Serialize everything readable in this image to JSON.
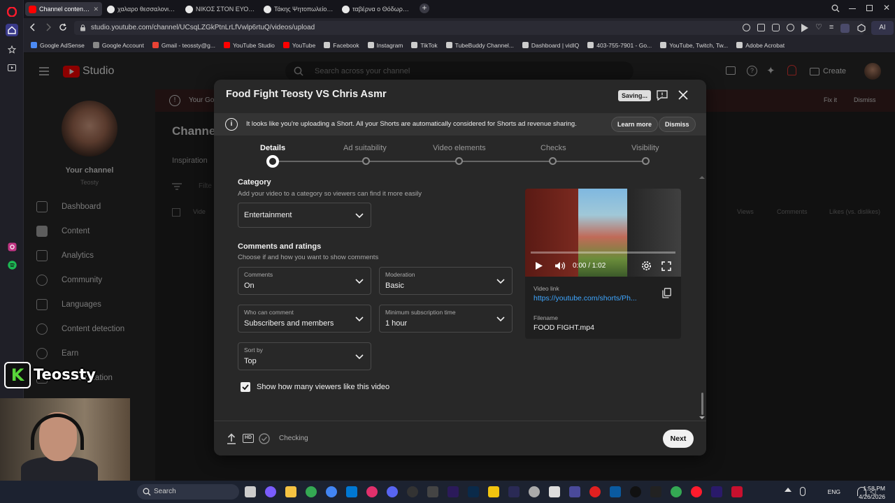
{
  "browser": {
    "tabs": [
      {
        "label": "Channel content - YouTub",
        "color": "#ff0000",
        "active": true
      },
      {
        "label": "χαλαρο θεσσαλονικη - Go",
        "color": "#e8e8e8",
        "active": false
      },
      {
        "label": "ΝΙΚΟΣ ΣΤΟΝ ΕΥΟΣΜΟ - G",
        "color": "#e8e8e8",
        "active": false
      },
      {
        "label": "Τάκης Ψητοπωλείο - Goo",
        "color": "#e8e8e8",
        "active": false
      },
      {
        "label": "ταβέρνα ο Θόδωρος - Go",
        "color": "#e8e8e8",
        "active": false
      }
    ],
    "url": "studio.youtube.com/channel/UCsqLZGkPtnLrLfVwlp6rtuQ/videos/upload",
    "ai_label": "AI",
    "bookmarks": [
      {
        "label": "Google AdSense",
        "color": "#4c8bf5"
      },
      {
        "label": "Google Account",
        "color": "#888"
      },
      {
        "label": "Gmail - teossty@g...",
        "color": "#ea4335"
      },
      {
        "label": "YouTube Studio",
        "color": "#ff0000"
      },
      {
        "label": "YouTube",
        "color": "#ff0000"
      },
      {
        "label": "Facebook",
        "color": "#ccc"
      },
      {
        "label": "Instagram",
        "color": "#ccc"
      },
      {
        "label": "TikTok",
        "color": "#ccc"
      },
      {
        "label": "TubeBuddy Channel...",
        "color": "#ccc"
      },
      {
        "label": "Dashboard | vidIQ",
        "color": "#ccc"
      },
      {
        "label": "403-755-7901 - Go...",
        "color": "#ccc"
      },
      {
        "label": "YouTube, Twitch, Tw...",
        "color": "#ccc"
      },
      {
        "label": "Adobe Acrobat",
        "color": "#ccc"
      }
    ]
  },
  "studio": {
    "logo": "Studio",
    "search_placeholder": "Search across your channel",
    "create_label": "Create",
    "warning_text": "Your Go",
    "fix_it": "Fix it",
    "dismiss": "Dismiss",
    "page_title": "Channe",
    "tab_inspiration": "Inspiration",
    "filter_label": "Filte",
    "col_video": "Vide",
    "col_views": "Views",
    "col_comments": "Comments",
    "col_likes": "Likes (vs. dislikes)",
    "channel_label": "Your channel",
    "channel_name": "Teosty",
    "nav": [
      "Dashboard",
      "Content",
      "Analytics",
      "Community",
      "Languages",
      "Content detection",
      "Earn",
      "Customization"
    ]
  },
  "dialog": {
    "title": "Food Fight Teosty VS Chris Asmr",
    "saving": "Saving...",
    "notice": "It looks like you're uploading a Short. All your Shorts are automatically considered for Shorts ad revenue sharing.",
    "learn_more": "Learn more",
    "dismiss": "Dismiss",
    "steps": [
      "Details",
      "Ad suitability",
      "Video elements",
      "Checks",
      "Visibility"
    ],
    "category": {
      "title": "Category",
      "subtitle": "Add your video to a category so viewers can find it more easily",
      "value": "Entertainment"
    },
    "comments": {
      "title": "Comments and ratings",
      "subtitle": "Choose if and how you want to show comments",
      "comments_cap": "Comments",
      "comments_val": "On",
      "moderation_cap": "Moderation",
      "moderation_val": "Basic",
      "who_cap": "Who can comment",
      "who_val": "Subscribers and members",
      "minsub_cap": "Minimum subscription time",
      "minsub_val": "1 hour",
      "sort_cap": "Sort by",
      "sort_val": "Top",
      "show_likes": "Show how many viewers like this video"
    },
    "video": {
      "time": "0:00 / 1:02",
      "link_cap": "Video link",
      "link": "https://youtube.com/shorts/Ph...",
      "filename_cap": "Filename",
      "filename": "FOOD FIGHT.mp4"
    },
    "footer": {
      "checking": "Checking",
      "hd": "HD",
      "next": "Next"
    }
  },
  "overlay": {
    "badge": "K",
    "name": "Teossty"
  },
  "taskbar": {
    "search": "Search",
    "lang": "ENG",
    "time": "1:58 PM",
    "date": "4/26/2026"
  }
}
